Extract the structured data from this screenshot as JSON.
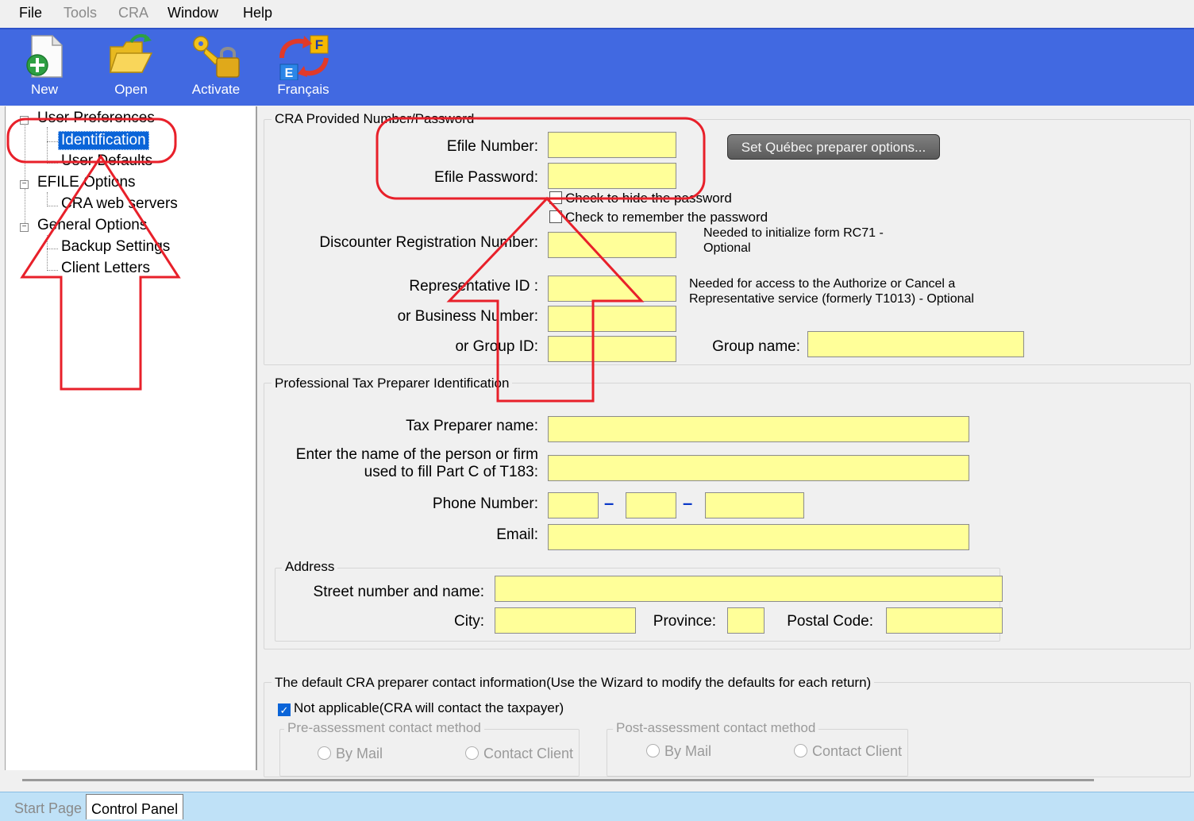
{
  "menu": {
    "file": "File",
    "tools": "Tools",
    "cra": "CRA",
    "window": "Window",
    "help": "Help"
  },
  "toolbar": {
    "new": "New",
    "open": "Open",
    "activate": "Activate",
    "francais": "Français",
    "flag_f": "F",
    "flag_e": "E"
  },
  "tree": {
    "user_preferences": "User Preferences",
    "identification": "Identification",
    "user_defaults": "User Defaults",
    "efile_options": "EFILE Options",
    "cra_web_servers": "CRA web servers",
    "general_options": "General Options",
    "backup_settings": "Backup Settings",
    "client_letters": "Client Letters"
  },
  "cra_group": {
    "title": "CRA Provided Number/Password",
    "efile_number": "Efile Number:",
    "efile_password": "Efile Password:",
    "hide_password": "Check to hide the password",
    "remember_password": "Check to remember the password",
    "discounter": "Discounter Registration Number:",
    "discounter_note": "Needed to initialize form RC71 - Optional",
    "rep_id": "Representative ID :",
    "rep_note": "Needed for access to the Authorize or Cancel a Representative service (formerly T1013) - Optional",
    "business_number": "or Business Number:",
    "group_id": "or Group ID:",
    "group_name": "Group name:",
    "quebec_button": "Set Québec preparer options..."
  },
  "preparer_group": {
    "title": "Professional Tax Preparer Identification",
    "name": "Tax Preparer name:",
    "firm": "Enter the name of the person or firm used to fill Part C of T183:",
    "phone": "Phone Number:",
    "dash": "–",
    "email": "Email:",
    "address_title": "Address",
    "street": "Street number and name:",
    "city": "City:",
    "province": "Province:",
    "postal": "Postal Code:"
  },
  "contact_group": {
    "title": "The default CRA preparer contact information(Use the Wizard to modify the defaults for each return)",
    "not_applicable": "Not applicable(CRA will contact the taxpayer)",
    "checkmark": "✓",
    "pre_title": "Pre-assessment contact method",
    "post_title": "Post-assessment contact method",
    "by_mail": "By Mail",
    "contact_client": "Contact Client"
  },
  "tabs": {
    "start_page": "Start Page",
    "control_panel": "Control Panel"
  },
  "colors": {
    "toolbar_bg": "#4169e1",
    "field_bg": "#ffff99",
    "selection": "#0a64d8",
    "annotation_red": "#e8202a"
  }
}
